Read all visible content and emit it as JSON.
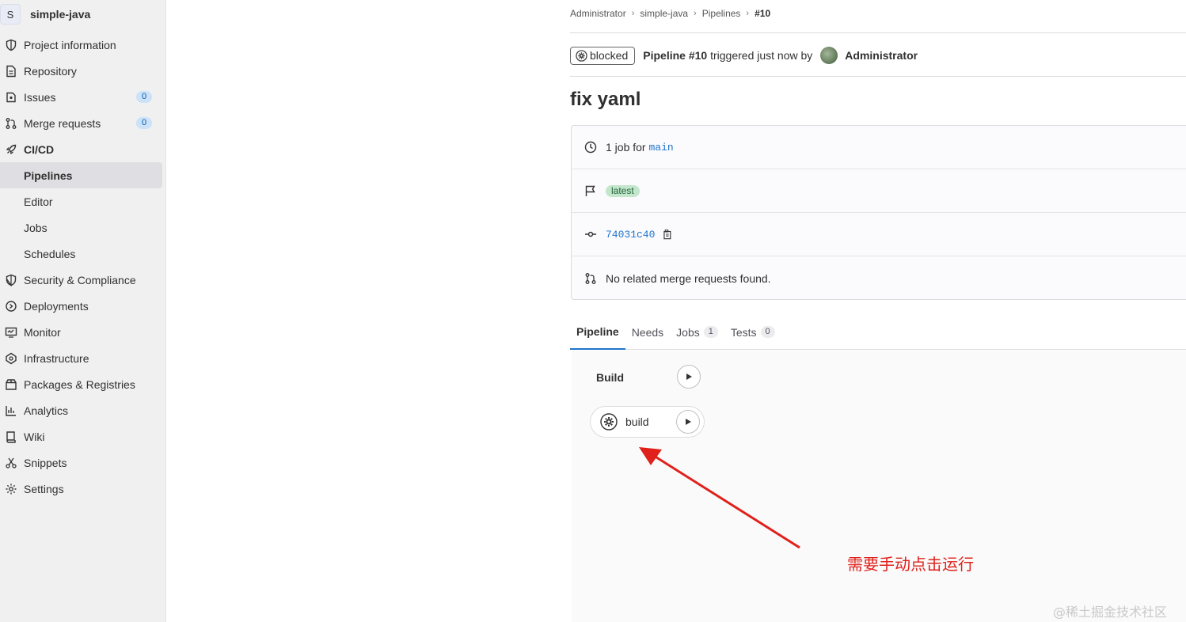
{
  "project": {
    "avatar_letter": "S",
    "name": "simple-java"
  },
  "sidebar": {
    "items": [
      {
        "label": "Project information",
        "icon": "info-icon"
      },
      {
        "label": "Repository",
        "icon": "doc-icon"
      },
      {
        "label": "Issues",
        "icon": "issues-icon",
        "count": "0"
      },
      {
        "label": "Merge requests",
        "icon": "merge-request-icon",
        "count": "0"
      },
      {
        "label": "CI/CD",
        "icon": "rocket-icon"
      },
      {
        "label": "Pipelines"
      },
      {
        "label": "Editor"
      },
      {
        "label": "Jobs"
      },
      {
        "label": "Schedules"
      },
      {
        "label": "Security & Compliance",
        "icon": "shield-icon"
      },
      {
        "label": "Deployments",
        "icon": "deployments-icon"
      },
      {
        "label": "Monitor",
        "icon": "monitor-icon"
      },
      {
        "label": "Infrastructure",
        "icon": "infrastructure-icon"
      },
      {
        "label": "Packages & Registries",
        "icon": "package-icon"
      },
      {
        "label": "Analytics",
        "icon": "analytics-icon"
      },
      {
        "label": "Wiki",
        "icon": "book-icon"
      },
      {
        "label": "Snippets",
        "icon": "snippet-icon"
      },
      {
        "label": "Settings",
        "icon": "settings-icon"
      }
    ]
  },
  "breadcrumb": [
    "Administrator",
    "simple-java",
    "Pipelines",
    "#10"
  ],
  "header": {
    "status": "blocked",
    "pipeline_label": "Pipeline #10",
    "triggered_text": "triggered just now by",
    "user": "Administrator"
  },
  "title": "fix yaml",
  "info": {
    "jobs_prefix": "1 job for",
    "branch": "main",
    "tag": "latest",
    "commit": "74031c40",
    "merge_requests": "No related merge requests found."
  },
  "tabs": {
    "pipeline": "Pipeline",
    "needs": "Needs",
    "jobs": "Jobs",
    "jobs_count": "1",
    "tests": "Tests",
    "tests_count": "0"
  },
  "graph": {
    "stage": "Build",
    "job": "build"
  },
  "annotation": {
    "text": "需要手动点击运行",
    "color": "#e0211b"
  },
  "watermark": "@稀土掘金技术社区"
}
